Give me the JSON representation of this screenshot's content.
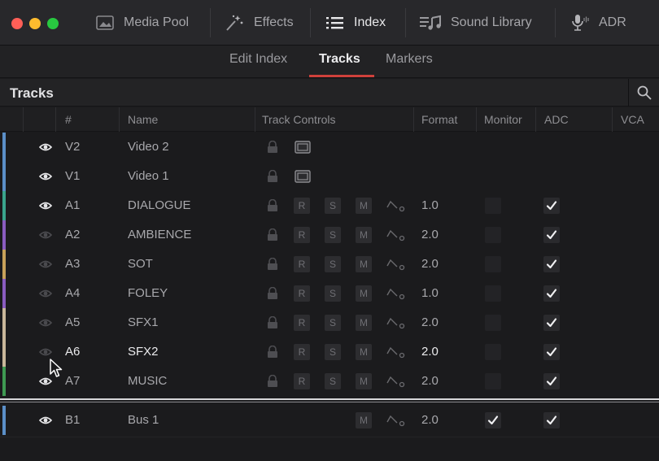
{
  "window": {
    "traffic_lights": [
      "#ff5f57",
      "#febc2e",
      "#28c840"
    ]
  },
  "toolbar": {
    "items": [
      {
        "label": "Media Pool",
        "icon": "media-pool-icon"
      },
      {
        "label": "Effects",
        "icon": "effects-wand-icon"
      },
      {
        "label": "Index",
        "icon": "index-list-icon",
        "active": true
      },
      {
        "label": "Sound Library",
        "icon": "sound-library-icon"
      },
      {
        "label": "ADR",
        "icon": "microphone-icon"
      }
    ]
  },
  "subtabs": {
    "items": [
      "Edit Index",
      "Tracks",
      "Markers"
    ],
    "active": "Tracks"
  },
  "panel": {
    "title": "Tracks"
  },
  "columns": {
    "num": "#",
    "name": "Name",
    "controls": "Track Controls",
    "format": "Format",
    "monitor": "Monitor",
    "adc": "ADC",
    "vca": "VCA"
  },
  "buttons": {
    "record": "R",
    "solo": "S",
    "mute": "M"
  },
  "tracks": [
    {
      "num": "V2",
      "name": "Video 2",
      "kind": "video",
      "eye_on": true,
      "format": "",
      "monitor": false,
      "adc": false,
      "color": "#5b8fc8"
    },
    {
      "num": "V1",
      "name": "Video 1",
      "kind": "video",
      "eye_on": true,
      "format": "",
      "monitor": false,
      "adc": false,
      "color": "#5b8fc8"
    },
    {
      "num": "A1",
      "name": "DIALOGUE",
      "kind": "audio",
      "eye_on": true,
      "format": "1.0",
      "monitor": false,
      "adc": true,
      "color": "#3aa58d"
    },
    {
      "num": "A2",
      "name": "AMBIENCE",
      "kind": "audio",
      "eye_on": false,
      "format": "2.0",
      "monitor": false,
      "adc": true,
      "color": "#8a5cc0"
    },
    {
      "num": "A3",
      "name": "SOT",
      "kind": "audio",
      "eye_on": false,
      "format": "2.0",
      "monitor": false,
      "adc": true,
      "color": "#c8a25a"
    },
    {
      "num": "A4",
      "name": "FOLEY",
      "kind": "audio",
      "eye_on": false,
      "format": "1.0",
      "monitor": false,
      "adc": true,
      "color": "#8a5cc0"
    },
    {
      "num": "A5",
      "name": "SFX1",
      "kind": "audio",
      "eye_on": false,
      "format": "2.0",
      "monitor": false,
      "adc": true,
      "color": "#c9b79a"
    },
    {
      "num": "A6",
      "name": "SFX2",
      "kind": "audio",
      "eye_on": false,
      "format": "2.0",
      "monitor": false,
      "adc": true,
      "color": "#c9b79a",
      "highlight": true
    },
    {
      "num": "A7",
      "name": "MUSIC",
      "kind": "audio",
      "eye_on": true,
      "format": "2.0",
      "monitor": false,
      "adc": true,
      "color": "#3f9a52"
    }
  ],
  "bus": {
    "num": "B1",
    "name": "Bus 1",
    "eye_on": true,
    "format": "2.0",
    "monitor": true,
    "adc": true,
    "color": "#5b8fc8"
  },
  "colors": {
    "accent_red": "#d0413b",
    "background": "#1b1b1d"
  }
}
